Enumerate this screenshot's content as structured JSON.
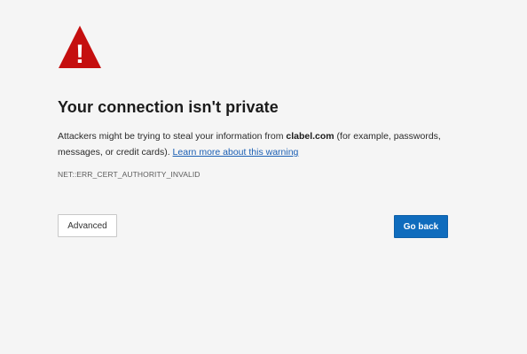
{
  "warning": {
    "icon": "warning-triangle-icon",
    "icon_color": "#c50f0f",
    "glyph": "!"
  },
  "title": "Your connection isn't private",
  "description": {
    "prefix": "Attackers might be trying to steal your information from ",
    "domain": "clabel.com",
    "suffix": " (for example, passwords, messages, or credit cards). ",
    "link_text": "Learn more about this warning"
  },
  "error_code": "NET::ERR_CERT_AUTHORITY_INVALID",
  "buttons": {
    "advanced_label": "Advanced",
    "go_back_label": "Go back",
    "primary_color": "#0f6cbd"
  }
}
